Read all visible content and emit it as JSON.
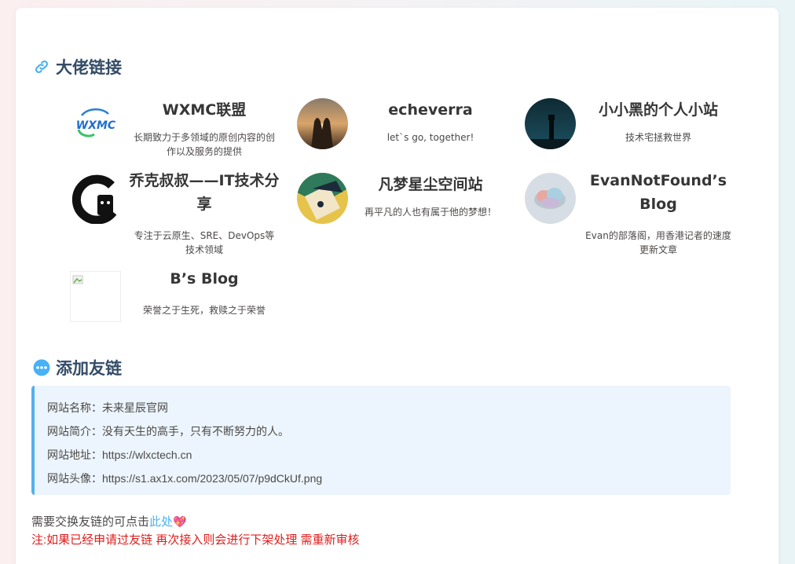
{
  "sections": {
    "links_heading": "大佬链接",
    "add_heading": "添加友链"
  },
  "friends": [
    {
      "name": "WXMC联盟",
      "desc": "长期致力于多领域的原创内容的创作以及服务的提供",
      "avatar_icon": "wxmc-logo"
    },
    {
      "name": "echeverra",
      "desc": "let`s go, together!",
      "avatar_icon": "sunset-couple-photo"
    },
    {
      "name": "小小黑的个人小站",
      "desc": "技术宅拯救世界",
      "avatar_icon": "dark-night-figure-photo"
    },
    {
      "name": "乔克叔叔——IT技术分享",
      "desc": "专注于云原生、SRE、DevOps等技术领域",
      "avatar_icon": "black-g-logo"
    },
    {
      "name": "凡梦星尘空间站",
      "desc": "再平凡的人也有属于他的梦想！",
      "avatar_icon": "anime-character-avatar"
    },
    {
      "name": "EvanNotFound’s Blog",
      "desc": "Evan的部落阁，用香港记者的速度更新文章",
      "avatar_icon": "cloud-avatar"
    },
    {
      "name": "B’s Blog",
      "desc": "荣誉之于生死，救赎之于荣誉",
      "avatar_icon": "broken-image-icon"
    }
  ],
  "site_info": {
    "name": "网站名称：未来星辰官网",
    "intro": "网站简介：没有天生的高手，只有不断努力的人。",
    "url": "网站地址：https://wlxctech.cn",
    "avatar": "网站头像：https://s1.ax1x.com/2023/05/07/p9dCkUf.png"
  },
  "notice": {
    "prefix": "需要交换友链的可点击",
    "link_text": "此处",
    "heart": "💖",
    "warning": "注:如果已经申请过友链 再次接入则会进行下架处理 需重新审核"
  },
  "colors": {
    "heading": "#344c67",
    "accent": "#49b1f5",
    "warning": "#e01d1d",
    "info_bg": "#ecf5fd"
  }
}
